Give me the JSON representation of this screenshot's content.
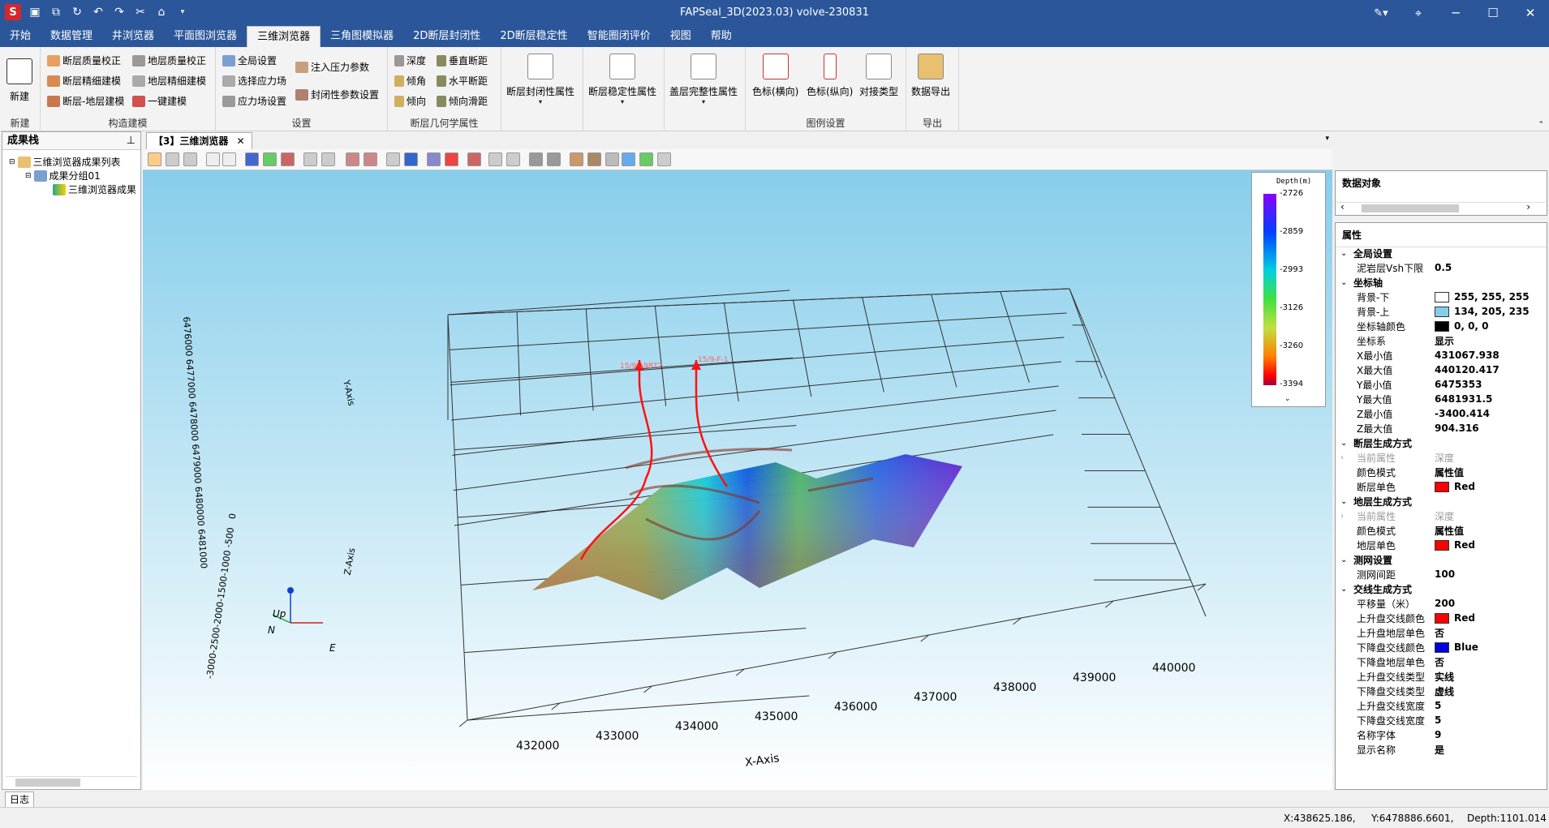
{
  "app": {
    "title": "FAPSeal_3D(2023.03) volve-230831",
    "logo": "S"
  },
  "menu": [
    "开始",
    "数据管理",
    "井浏览器",
    "平面图浏览器",
    "三维浏览器",
    "三角图模拟器",
    "2D断层封闭性",
    "2D断层稳定性",
    "智能圈闭评价",
    "视图",
    "帮助"
  ],
  "menu_active": "三维浏览器",
  "ribbon": {
    "new": {
      "label": "新建",
      "group": "新建"
    },
    "build": {
      "group": "构造建模",
      "items": [
        "断层质量校正",
        "断层精细建模",
        "断层-地层建模",
        "地层质量校正",
        "地层精细建模",
        "一键建模"
      ]
    },
    "settings": {
      "group": "设置",
      "items": [
        "全局设置",
        "选择应力场",
        "应力场设置",
        "注入压力参数",
        "封闭性参数设置"
      ]
    },
    "geom": {
      "group": "断层几何学属性",
      "items": [
        "深度",
        "倾角",
        "倾向",
        "垂直断距",
        "水平断距",
        "倾向滑距"
      ]
    },
    "big": [
      "断层封闭性属性",
      "断层稳定性属性",
      "盖层完整性属性"
    ],
    "legendset": {
      "group": "图例设置",
      "items": [
        "色标(横向)",
        "色标(纵向)",
        "对接类型"
      ]
    },
    "export": {
      "group": "导出",
      "label": "数据导出"
    }
  },
  "left": {
    "title": "成果栈",
    "pin": "ᵖ",
    "tree": [
      "三维浏览器成果列表",
      "成果分组01",
      "三维浏览器成果"
    ]
  },
  "doc": {
    "tab": "【3】三维浏览器",
    "close": "✕"
  },
  "view": {
    "legend_title": "Depth(m)",
    "legend_ticks": [
      "-2726",
      "-2859",
      "-2993",
      "-3126",
      "-3260",
      "-3394"
    ],
    "x_axis": "X-Axis",
    "y_axis": "Y-Axis",
    "z_axis": "Z-Axis",
    "x_ticks": [
      "432000",
      "433000",
      "434000",
      "435000",
      "436000",
      "437000",
      "438000",
      "439000",
      "440000"
    ],
    "z_ticks": "-3000-2500-2000-1500-1000 -500   0",
    "y_ticks": "6476000  6477000  6478000  6479000  6480000 6481000",
    "wells": [
      "15/9-19BT2",
      "15/9-F-1"
    ],
    "compass": {
      "up": "Up",
      "n": "N",
      "e": "E"
    }
  },
  "data_objects": {
    "title": "数据对象"
  },
  "props": {
    "title": "属性",
    "rows": [
      {
        "t": "cat",
        "k": "全局设置"
      },
      {
        "k": "泥岩层Vsh下限",
        "v": "0.5"
      },
      {
        "t": "cat",
        "k": "坐标轴"
      },
      {
        "k": "背景-下",
        "v": "255, 255, 255",
        "c": "#ffffff"
      },
      {
        "k": "背景-上",
        "v": "134, 205, 235",
        "c": "#86cdeb"
      },
      {
        "k": "坐标轴颜色",
        "v": "0, 0, 0",
        "c": "#000000"
      },
      {
        "k": "坐标系",
        "v": "显示"
      },
      {
        "k": "X最小值",
        "v": "431067.938"
      },
      {
        "k": "X最大值",
        "v": "440120.417"
      },
      {
        "k": "Y最小值",
        "v": "6475353"
      },
      {
        "k": "Y最大值",
        "v": "6481931.5"
      },
      {
        "k": "Z最小值",
        "v": "-3400.414"
      },
      {
        "k": "Z最大值",
        "v": "904.316"
      },
      {
        "t": "cat",
        "k": "断层生成方式"
      },
      {
        "t": "sub",
        "k": "当前属性",
        "v": "深度"
      },
      {
        "k": "颜色模式",
        "v": "属性值"
      },
      {
        "k": "断层单色",
        "v": "Red",
        "c": "#ff0000"
      },
      {
        "t": "cat",
        "k": "地层生成方式"
      },
      {
        "t": "sub",
        "k": "当前属性",
        "v": "深度"
      },
      {
        "k": "颜色模式",
        "v": "属性值"
      },
      {
        "k": "地层单色",
        "v": "Red",
        "c": "#ff0000"
      },
      {
        "t": "cat",
        "k": "测网设置"
      },
      {
        "k": "测网间距",
        "v": "100"
      },
      {
        "t": "cat",
        "k": "交线生成方式"
      },
      {
        "k": "平移量（米）",
        "v": "200"
      },
      {
        "k": "上升盘交线颜色",
        "v": "Red",
        "c": "#ff0000"
      },
      {
        "k": "上升盘地层单色",
        "v": "否"
      },
      {
        "k": "下降盘交线颜色",
        "v": "Blue",
        "c": "#0000dd"
      },
      {
        "k": "下降盘地层单色",
        "v": "否"
      },
      {
        "k": "上升盘交线类型",
        "v": "实线"
      },
      {
        "k": "下降盘交线类型",
        "v": "虚线"
      },
      {
        "k": "上升盘交线宽度",
        "v": "5"
      },
      {
        "k": "下降盘交线宽度",
        "v": "5"
      },
      {
        "k": "名称字体",
        "v": "9"
      },
      {
        "k": "显示名称",
        "v": "是"
      }
    ]
  },
  "log_tab": "日志",
  "status": {
    "x": "X:438625.186,",
    "y": "Y:6478886.6601,",
    "depth": "Depth:1101.014"
  }
}
